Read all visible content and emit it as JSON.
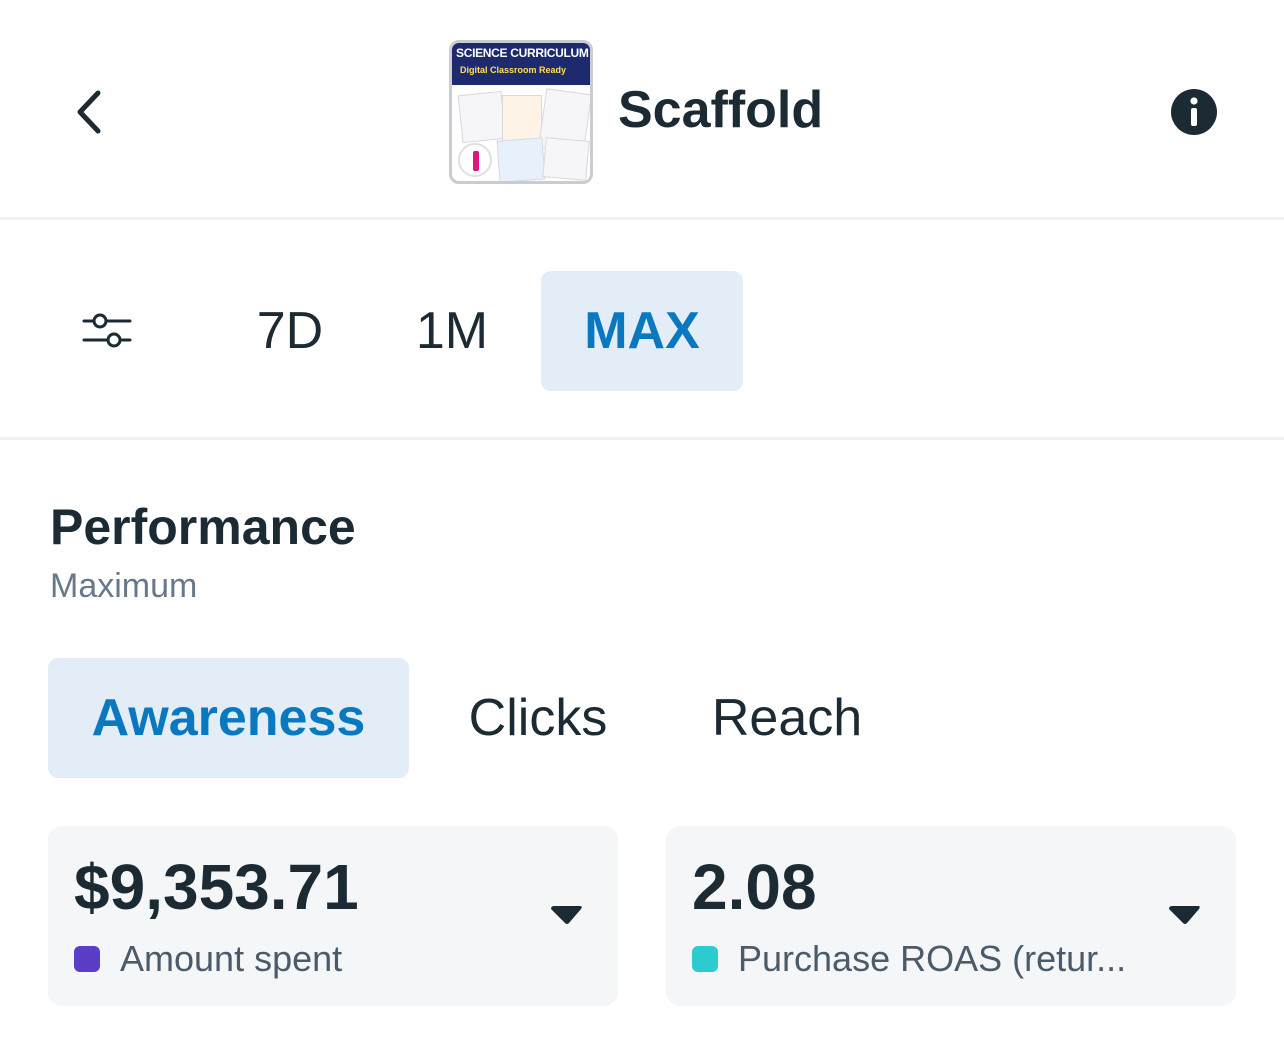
{
  "header": {
    "title": "Scaffold",
    "thumbnail": {
      "line1": "SCIENCE CURRICULUM",
      "line2": "Digital Classroom Ready"
    }
  },
  "range_tabs": [
    {
      "label": "7D",
      "active": false
    },
    {
      "label": "1M",
      "active": false
    },
    {
      "label": "MAX",
      "active": true
    }
  ],
  "performance": {
    "title": "Performance",
    "subtitle": "Maximum"
  },
  "metric_tabs": [
    {
      "label": "Awareness",
      "active": true
    },
    {
      "label": "Clicks",
      "active": false
    },
    {
      "label": "Reach",
      "active": false
    }
  ],
  "cards": [
    {
      "value": "$9,353.71",
      "label": "Amount spent",
      "color": "#5b3ec7"
    },
    {
      "value": "2.08",
      "label": "Purchase ROAS (retur...",
      "color": "#2ccbd0"
    }
  ],
  "colors": {
    "accent": "#0a78be",
    "active_tab_bg": "#e2edf7",
    "text": "#1c2b33"
  },
  "icons": {
    "back": "chevron-left-icon",
    "info": "info-icon",
    "filter": "sliders-icon",
    "dropdown": "caret-down-icon"
  }
}
